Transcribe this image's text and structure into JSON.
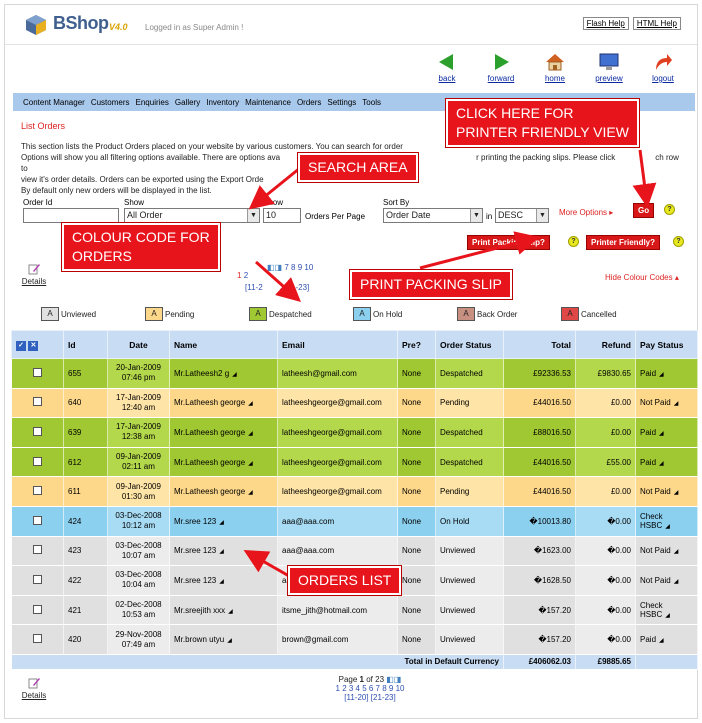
{
  "app": {
    "name": "BShop",
    "version": "V4.0",
    "logged_in": "Logged in as Super Admin !",
    "flash_help": "Flash Help",
    "html_help": "HTML Help"
  },
  "navicons": [
    {
      "label": "back",
      "icon": "back-arrow-icon",
      "color": "#2ca02c"
    },
    {
      "label": "forward",
      "icon": "forward-arrow-icon",
      "color": "#2ca02c"
    },
    {
      "label": "home",
      "icon": "home-icon",
      "color": "#d06020"
    },
    {
      "label": "preview",
      "icon": "monitor-icon",
      "color": "#2040a0"
    },
    {
      "label": "logout",
      "icon": "logout-arrow-icon",
      "color": "#e04020"
    }
  ],
  "menu": [
    "Content Manager",
    "Customers",
    "Enquiries",
    "Gallery",
    "Inventory",
    "Maintenance",
    "Orders",
    "Settings",
    "Tools"
  ],
  "page": {
    "title": "List Orders",
    "desc1": "This section lists the Product Orders placed on your website by various customers. You can search for order",
    "desc2": "Options will show you all filtering options available. There are options ava",
    "desc2b": "r printing the packing slips. Please click",
    "desc2c": "ch row to",
    "desc3": "view it's order details. Orders can be exported using the Export Orde",
    "desc4": "By default only new orders will be displayed in the list."
  },
  "filter": {
    "order_id_label": "Order Id",
    "order_id_value": "",
    "show_label": "Show",
    "show_value": "All Order",
    "show2_label": "Show",
    "per_page_value": "10",
    "per_page_suffix": "Orders Per Page",
    "sort_label": "Sort By",
    "sort_value": "Order Date",
    "in_label": "in",
    "dir_value": "DESC",
    "more_options": "More Options",
    "go": "Go"
  },
  "actions": {
    "print_slip": "Print Packing Slip?",
    "printer_friendly": "Printer Friendly?",
    "hide_colour": "Hide Colour Codes",
    "details": "Details",
    "help": "?"
  },
  "pager_top": {
    "pages": "1 2 3 4 5 6 7 8 9 10",
    "visible_pages": "7 8 9 10",
    "ranges": "[11-20] [21-23]",
    "visible_ranges": "[11-2",
    "visible_ranges_b": "1-23]",
    "first_page": "1",
    "second_page": "2"
  },
  "legend": [
    {
      "label": "Unviewed",
      "color": "#e0e0e0"
    },
    {
      "label": "Pending",
      "color": "#fed88a"
    },
    {
      "label": "Despatched",
      "color": "#a0c832"
    },
    {
      "label": "On Hold",
      "color": "#8cd0f0"
    },
    {
      "label": "Back Order",
      "color": "#c89080"
    },
    {
      "label": "Cancelled",
      "color": "#e04848"
    }
  ],
  "legend_swatch_letter": "A",
  "table": {
    "headers": [
      "Id",
      "Date",
      "Name",
      "Email",
      "Pre?",
      "Order Status",
      "Total",
      "Refund",
      "Pay Status"
    ],
    "rows": [
      {
        "id": "655",
        "date1": "20-Jan-2009",
        "date2": "07:46 pm",
        "name": "Mr.Latheesh2 g",
        "email": "latheesh@gmail.com",
        "pre": "None",
        "status": "Despatched",
        "total": "£92336.53",
        "refund": "£9830.65",
        "pay": "Paid",
        "color": "#a0c832",
        "dcolor": "#b4d84c"
      },
      {
        "id": "640",
        "date1": "17-Jan-2009",
        "date2": "12:40 am",
        "name": "Mr.Latheesh george",
        "email": "latheeshgeorge@gmail.com",
        "pre": "None",
        "status": "Pending",
        "total": "£44016.50",
        "refund": "£0.00",
        "pay": "Not Paid",
        "color": "#fed88a",
        "dcolor": "#fee4a6"
      },
      {
        "id": "639",
        "date1": "17-Jan-2009",
        "date2": "12:38 am",
        "name": "Mr.Latheesh george",
        "email": "latheeshgeorge@gmail.com",
        "pre": "None",
        "status": "Despatched",
        "total": "£88016.50",
        "refund": "£0.00",
        "pay": "Paid",
        "color": "#a0c832",
        "dcolor": "#b4d84c"
      },
      {
        "id": "612",
        "date1": "09-Jan-2009",
        "date2": "02:11 am",
        "name": "Mr.Latheesh george",
        "email": "latheeshgeorge@gmail.com",
        "pre": "None",
        "status": "Despatched",
        "total": "£44016.50",
        "refund": "£55.00",
        "pay": "Paid",
        "color": "#a0c832",
        "dcolor": "#b4d84c"
      },
      {
        "id": "611",
        "date1": "09-Jan-2009",
        "date2": "01:30 am",
        "name": "Mr.Latheesh george",
        "email": "latheeshgeorge@gmail.com",
        "pre": "None",
        "status": "Pending",
        "total": "£44016.50",
        "refund": "£0.00",
        "pay": "Not Paid",
        "color": "#fed88a",
        "dcolor": "#fee4a6"
      },
      {
        "id": "424",
        "date1": "03-Dec-2008",
        "date2": "10:12 am",
        "name": "Mr.sree 123",
        "email": "aaa@aaa.com",
        "pre": "None",
        "status": "On Hold",
        "total": "�10013.80",
        "refund": "�0.00",
        "pay": "Check HSBC",
        "color": "#8cd0f0",
        "dcolor": "#a8dcf4"
      },
      {
        "id": "423",
        "date1": "03-Dec-2008",
        "date2": "10:07 am",
        "name": "Mr.sree 123",
        "email": "aaa@aaa.com",
        "pre": "None",
        "status": "Unviewed",
        "total": "�1623.00",
        "refund": "�0.00",
        "pay": "Not Paid",
        "color": "#e0e0e0",
        "dcolor": "#ececec"
      },
      {
        "id": "422",
        "date1": "03-Dec-2008",
        "date2": "10:04 am",
        "name": "Mr.sree 123",
        "email": "aaa@aaa.com",
        "pre": "None",
        "status": "Unviewed",
        "total": "�1628.50",
        "refund": "�0.00",
        "pay": "Not Paid",
        "color": "#e0e0e0",
        "dcolor": "#ececec"
      },
      {
        "id": "421",
        "date1": "02-Dec-2008",
        "date2": "10:53 am",
        "name": "Mr.sreejith xxx",
        "email": "itsme_jith@hotmail.com",
        "pre": "None",
        "status": "Unviewed",
        "total": "�157.20",
        "refund": "�0.00",
        "pay": "Check HSBC",
        "color": "#e0e0e0",
        "dcolor": "#ececec"
      },
      {
        "id": "420",
        "date1": "29-Nov-2008",
        "date2": "07:49 am",
        "name": "Mr.brown utyu",
        "email": "brown@gmail.com",
        "pre": "None",
        "status": "Unviewed",
        "total": "�157.20",
        "refund": "�0.00",
        "pay": "Paid",
        "color": "#e0e0e0",
        "dcolor": "#ececec"
      }
    ],
    "footer": {
      "label": "Total in Default Currency",
      "total": "£406062.03",
      "refund": "£9885.65"
    }
  },
  "pager_bottom": {
    "prefix": "Page",
    "current": "1",
    "of": "of 23",
    "pages": "1 2 3 4 5 6 7 8 9 10",
    "ranges": "[11-20] [21-23]"
  },
  "callouts": {
    "printer_friendly_1": "CLICK HERE FOR",
    "printer_friendly_2": "PRINTER FRIENDLY VIEW",
    "search_area": "SEARCH AREA",
    "colour_1": "COLOUR CODE FOR",
    "colour_2": "ORDERS",
    "print_slip": "PRINT PACKING SLIP",
    "orders_list": "ORDERS LIST"
  }
}
